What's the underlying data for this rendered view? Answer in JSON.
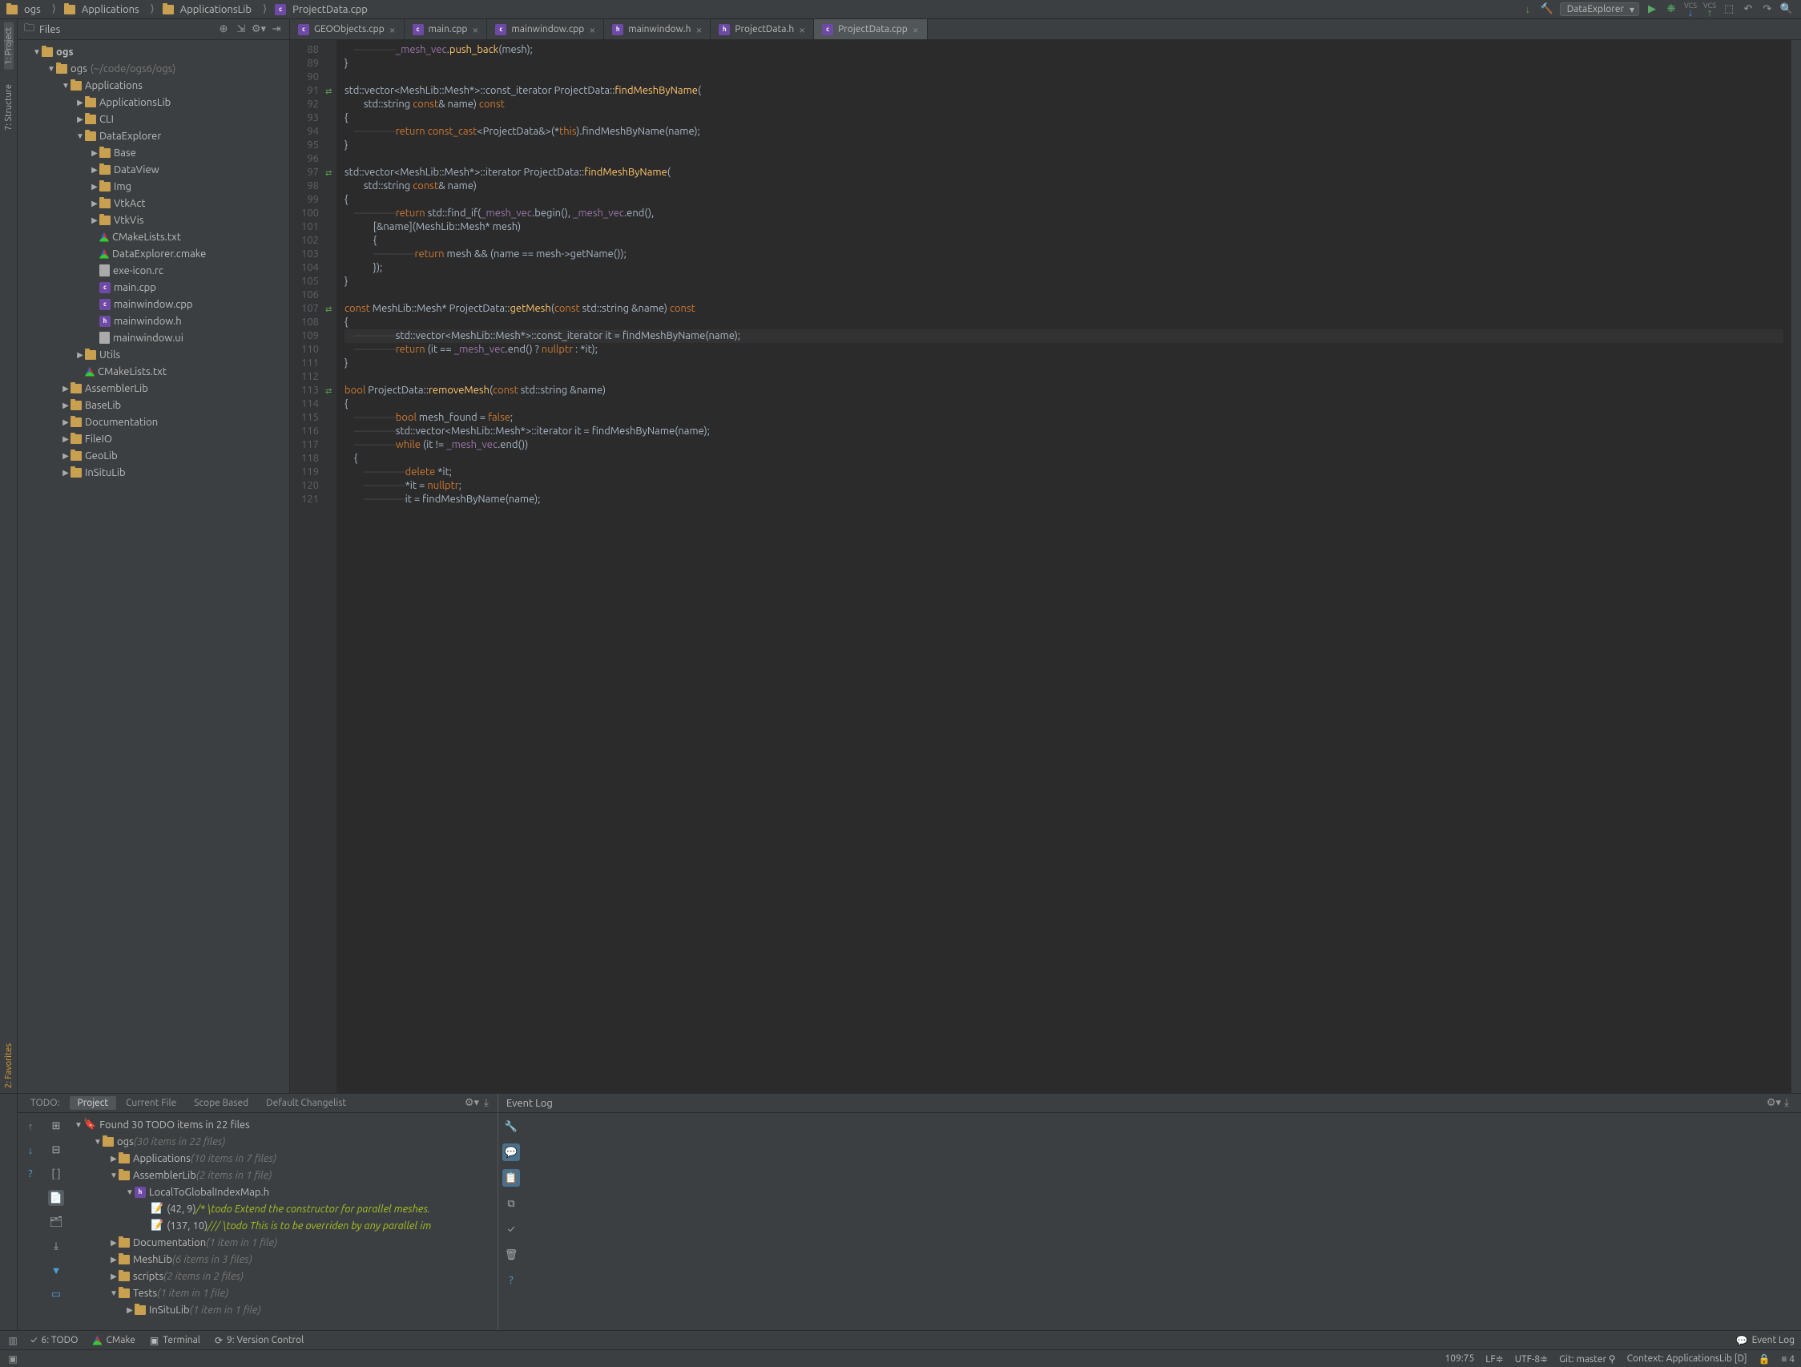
{
  "breadcrumb": [
    "ogs",
    "Applications",
    "ApplicationsLib",
    "ProjectData.cpp"
  ],
  "run_config": "DataExplorer",
  "sidebar": {
    "title": "Files",
    "root": "ogs",
    "root_note": "(~/code/ogs6/ogs)",
    "items": [
      {
        "d": 1,
        "arrow": "▼",
        "icon": "folder",
        "label": "ogs",
        "bold": true
      },
      {
        "d": 2,
        "arrow": "▼",
        "icon": "folder",
        "label": "ogs",
        "note": "(~/code/ogs6/ogs)"
      },
      {
        "d": 3,
        "arrow": "▼",
        "icon": "folder",
        "label": "Applications"
      },
      {
        "d": 4,
        "arrow": "▶",
        "icon": "folder",
        "label": "ApplicationsLib"
      },
      {
        "d": 4,
        "arrow": "▶",
        "icon": "folder",
        "label": "CLI"
      },
      {
        "d": 4,
        "arrow": "▼",
        "icon": "folder",
        "label": "DataExplorer"
      },
      {
        "d": 5,
        "arrow": "▶",
        "icon": "folder",
        "label": "Base"
      },
      {
        "d": 5,
        "arrow": "▶",
        "icon": "folder",
        "label": "DataView"
      },
      {
        "d": 5,
        "arrow": "▶",
        "icon": "folder",
        "label": "Img"
      },
      {
        "d": 5,
        "arrow": "▶",
        "icon": "folder",
        "label": "VtkAct"
      },
      {
        "d": 5,
        "arrow": "▶",
        "icon": "folder",
        "label": "VtkVis"
      },
      {
        "d": 5,
        "arrow": "",
        "icon": "cmake",
        "label": "CMakeLists.txt"
      },
      {
        "d": 5,
        "arrow": "",
        "icon": "cmake",
        "label": "DataExplorer.cmake"
      },
      {
        "d": 5,
        "arrow": "",
        "icon": "file",
        "label": "exe-icon.rc"
      },
      {
        "d": 5,
        "arrow": "",
        "icon": "cpp",
        "label": "main.cpp"
      },
      {
        "d": 5,
        "arrow": "",
        "icon": "cpp",
        "label": "mainwindow.cpp"
      },
      {
        "d": 5,
        "arrow": "",
        "icon": "h",
        "label": "mainwindow.h"
      },
      {
        "d": 5,
        "arrow": "",
        "icon": "file",
        "label": "mainwindow.ui"
      },
      {
        "d": 4,
        "arrow": "▶",
        "icon": "folder",
        "label": "Utils"
      },
      {
        "d": 4,
        "arrow": "",
        "icon": "cmake",
        "label": "CMakeLists.txt"
      },
      {
        "d": 3,
        "arrow": "▶",
        "icon": "folder",
        "label": "AssemblerLib"
      },
      {
        "d": 3,
        "arrow": "▶",
        "icon": "folder",
        "label": "BaseLib"
      },
      {
        "d": 3,
        "arrow": "▶",
        "icon": "folder",
        "label": "Documentation"
      },
      {
        "d": 3,
        "arrow": "▶",
        "icon": "folder",
        "label": "FileIO"
      },
      {
        "d": 3,
        "arrow": "▶",
        "icon": "folder",
        "label": "GeoLib"
      },
      {
        "d": 3,
        "arrow": "▶",
        "icon": "folder",
        "label": "InSituLib"
      }
    ]
  },
  "tabs": [
    {
      "icon": "cpp",
      "label": "GEOObjects.cpp"
    },
    {
      "icon": "cpp",
      "label": "main.cpp"
    },
    {
      "icon": "cpp",
      "label": "mainwindow.cpp"
    },
    {
      "icon": "h",
      "label": "mainwindow.h"
    },
    {
      "icon": "h",
      "label": "ProjectData.h"
    },
    {
      "icon": "cpp",
      "label": "ProjectData.cpp",
      "active": true
    }
  ],
  "code": {
    "first_line": 88,
    "lines": [
      {
        "html": "    <span class='ws'>————</span><span class='m'>_mesh_vec</span>.<span class='f'>push_back</span>(mesh);"
      },
      {
        "html": "}"
      },
      {
        "html": ""
      },
      {
        "html": "std::vector&lt;MeshLib::Mesh*&gt;::const_iterator ProjectData::<span class='f'>findMeshByName</span>(",
        "mark": "⇄"
      },
      {
        "html": "        std::string <span class='k'>const</span>&amp; name) <span class='k'>const</span>"
      },
      {
        "html": "{"
      },
      {
        "html": "    <span class='ws'>————</span><span class='k'>return</span> <span class='k'>const_cast</span>&lt;ProjectData&amp;&gt;(*<span class='k'>this</span>).findMeshByName(name);"
      },
      {
        "html": "}"
      },
      {
        "html": ""
      },
      {
        "html": "std::vector&lt;MeshLib::Mesh*&gt;::iterator ProjectData::<span class='f'>findMeshByName</span>(",
        "mark": "⇄"
      },
      {
        "html": "        std::string <span class='k'>const</span>&amp; name)"
      },
      {
        "html": "{"
      },
      {
        "html": "    <span class='ws'>————</span><span class='k'>return</span> std::find_if(<span class='m'>_mesh_vec</span>.begin(), <span class='m'>_mesh_vec</span>.end(),"
      },
      {
        "html": "            [&amp;name](MeshLib::Mesh* mesh)"
      },
      {
        "html": "            {"
      },
      {
        "html": "            <span class='ws'>————</span><span class='k'>return</span> mesh &amp;&amp; (name == mesh-&gt;getName());"
      },
      {
        "html": "            });"
      },
      {
        "html": "}"
      },
      {
        "html": ""
      },
      {
        "html": "<span class='k'>const</span> MeshLib::Mesh* ProjectData::<span class='f'>getMesh</span>(<span class='k'>const</span> std::string &amp;name) <span class='k'>const</span>",
        "mark": "⇄"
      },
      {
        "html": "{"
      },
      {
        "html": "    <span class='ws'>————</span>std::vector&lt;MeshLib::Mesh*&gt;::const_iterator it = findMeshByName(name);",
        "hl": true
      },
      {
        "html": "    <span class='ws'>————</span><span class='k'>return</span> (it == <span class='m'>_mesh_vec</span>.end() ? <span class='k'>nullptr</span> : *it);"
      },
      {
        "html": "}"
      },
      {
        "html": ""
      },
      {
        "html": "<span class='k'>bool</span> ProjectData::<span class='f'>removeMesh</span>(<span class='k'>const</span> std::string &amp;name)",
        "mark": "⇄"
      },
      {
        "html": "{"
      },
      {
        "html": "    <span class='ws'>————</span><span class='k'>bool</span> mesh_found = <span class='k'>false</span>;"
      },
      {
        "html": "    <span class='ws'>————</span>std::vector&lt;MeshLib::Mesh*&gt;::iterator it = findMeshByName(name);"
      },
      {
        "html": "    <span class='ws'>————</span><span class='k'>while</span> (it != <span class='m'>_mesh_vec</span>.end())"
      },
      {
        "html": "    {"
      },
      {
        "html": "        <span class='ws'>————</span><span class='k'>delete</span> *it;"
      },
      {
        "html": "        <span class='ws'>————</span>*it = <span class='k'>nullptr</span>;"
      },
      {
        "html": "        <span class='ws'>————</span>it = findMeshByName(name);"
      }
    ]
  },
  "todo": {
    "tabs": [
      "TODO:",
      "Project",
      "Current File",
      "Scope Based",
      "Default Changelist"
    ],
    "header": "Found 30 TODO items in 22 files",
    "items": [
      {
        "d": 1,
        "arrow": "▼",
        "icon": "folder",
        "label": "ogs",
        "note": "(30 items in 22 files)"
      },
      {
        "d": 2,
        "arrow": "▶",
        "icon": "folder",
        "label": "Applications",
        "note": "(10 items in 7 files)"
      },
      {
        "d": 2,
        "arrow": "▼",
        "icon": "folder",
        "label": "AssemblerLib",
        "note": "(2 items in 1 file)"
      },
      {
        "d": 3,
        "arrow": "▼",
        "icon": "h",
        "label": "LocalToGlobalIndexMap.h"
      },
      {
        "d": 4,
        "arrow": "",
        "icon": "todo",
        "label": "(42, 9)",
        "todo": "/* \\todo Extend the constructor for parallel meshes."
      },
      {
        "d": 4,
        "arrow": "",
        "icon": "todo",
        "label": "(137, 10)",
        "todo": "/// \\todo This is to be overriden by any parallel im"
      },
      {
        "d": 2,
        "arrow": "▶",
        "icon": "folder",
        "label": "Documentation",
        "note": "(1 item in 1 file)"
      },
      {
        "d": 2,
        "arrow": "▶",
        "icon": "folder",
        "label": "MeshLib",
        "note": "(6 items in 3 files)"
      },
      {
        "d": 2,
        "arrow": "▶",
        "icon": "folder",
        "label": "scripts",
        "note": "(2 items in 2 files)"
      },
      {
        "d": 2,
        "arrow": "▼",
        "icon": "folder",
        "label": "Tests",
        "note": "(1 item in 1 file)"
      },
      {
        "d": 3,
        "arrow": "▶",
        "icon": "folder",
        "label": "InSituLib",
        "note": "(1 item in 1 file)"
      }
    ]
  },
  "eventlog": {
    "title": "Event Log"
  },
  "status": {
    "todo": "6: TODO",
    "cmake": "CMake",
    "terminal": "Terminal",
    "vcs": "9: Version Control",
    "pos": "109:75",
    "le": "LF≑",
    "enc": "UTF-8≑",
    "git": "Git: master",
    "ctx": "Context: ApplicationsLib [D]",
    "eventlog": "Event Log",
    "problems": "≡ 4"
  },
  "left_tools": [
    "1: Project",
    "7: Structure"
  ],
  "left_bottom": "2: Favorites"
}
